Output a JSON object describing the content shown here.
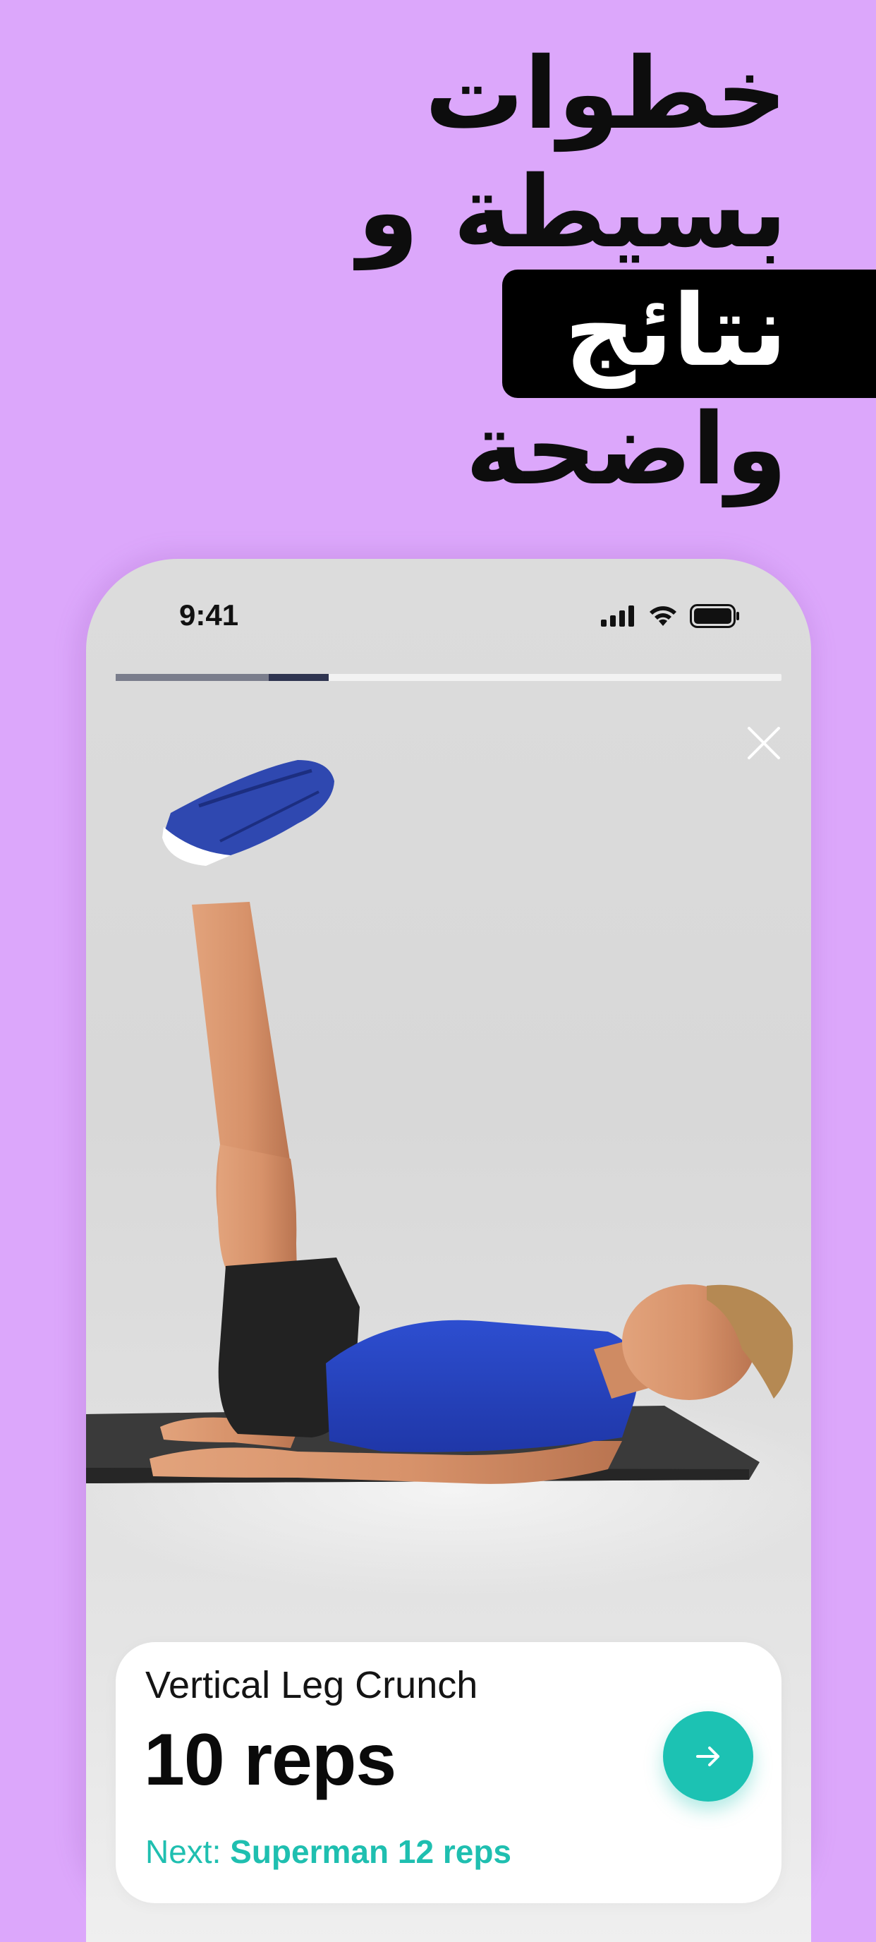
{
  "headline": {
    "line1": "خطوات",
    "line2": "بسيطة و",
    "line3": "نتائج",
    "line4": "واضحة"
  },
  "status_bar": {
    "time": "9:41",
    "icons": [
      "cellular-signal-icon",
      "wifi-icon",
      "battery-icon"
    ]
  },
  "workout_progress": {
    "completed_fraction": 0.23,
    "current_fraction": 0.32
  },
  "exercise_card": {
    "title": "Vertical Leg Crunch",
    "reps": "10 reps",
    "next_label": "Next:",
    "next_value": "Superman 12 reps",
    "next_button_icon": "arrow-right-icon"
  },
  "colors": {
    "background": "#dca7fb",
    "accent": "#1cc2b3",
    "headline_text": "#0d0d0d",
    "highlight_bg": "#000000"
  }
}
